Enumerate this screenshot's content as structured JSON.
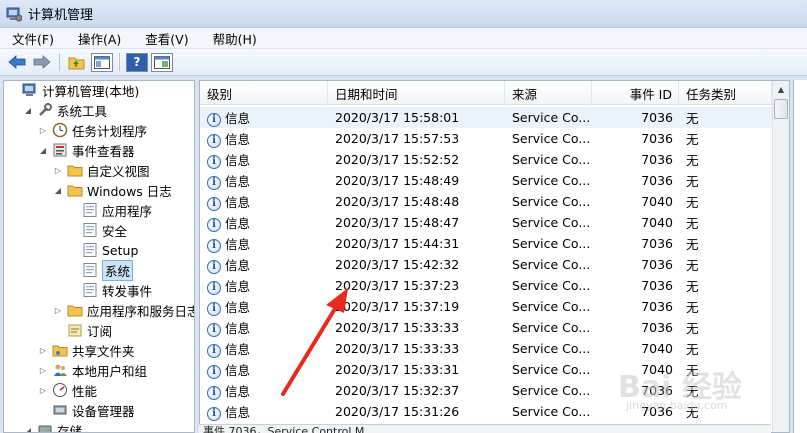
{
  "window": {
    "title": "计算机管理"
  },
  "menu": [
    "文件(F)",
    "操作(A)",
    "查看(V)",
    "帮助(H)"
  ],
  "toolbar": {
    "buttons": [
      "back-arrow-icon",
      "forward-arrow-icon",
      "up-folder-icon",
      "show-hide-tree-icon",
      "help-icon",
      "console-icon"
    ]
  },
  "tree": [
    {
      "label": "计算机管理(本地)",
      "icon": "computer-icon",
      "level": 0,
      "expander": ""
    },
    {
      "label": "系统工具",
      "icon": "tools-icon",
      "level": 1,
      "expander": "◢"
    },
    {
      "label": "任务计划程序",
      "icon": "clock-icon",
      "level": 2,
      "expander": "▷"
    },
    {
      "label": "事件查看器",
      "icon": "event-viewer-icon",
      "level": 2,
      "expander": "◢"
    },
    {
      "label": "自定义视图",
      "icon": "folder-icon",
      "level": 3,
      "expander": "▷"
    },
    {
      "label": "Windows 日志",
      "icon": "folder-icon",
      "level": 3,
      "expander": "◢"
    },
    {
      "label": "应用程序",
      "icon": "log-icon",
      "level": 4,
      "expander": ""
    },
    {
      "label": "安全",
      "icon": "log-icon",
      "level": 4,
      "expander": ""
    },
    {
      "label": "Setup",
      "icon": "log-icon",
      "level": 4,
      "expander": ""
    },
    {
      "label": "系统",
      "icon": "log-icon",
      "level": 4,
      "expander": "",
      "selected": true
    },
    {
      "label": "转发事件",
      "icon": "log-icon",
      "level": 4,
      "expander": ""
    },
    {
      "label": "应用程序和服务日志",
      "icon": "folder-icon",
      "level": 3,
      "expander": "▷"
    },
    {
      "label": "订阅",
      "icon": "subscription-icon",
      "level": 3,
      "expander": ""
    },
    {
      "label": "共享文件夹",
      "icon": "shared-folder-icon",
      "level": 2,
      "expander": "▷"
    },
    {
      "label": "本地用户和组",
      "icon": "users-icon",
      "level": 2,
      "expander": "▷"
    },
    {
      "label": "性能",
      "icon": "performance-icon",
      "level": 2,
      "expander": "▷"
    },
    {
      "label": "设备管理器",
      "icon": "device-manager-icon",
      "level": 2,
      "expander": ""
    },
    {
      "label": "存储",
      "icon": "storage-icon",
      "level": 1,
      "expander": "◢"
    }
  ],
  "table": {
    "columns": [
      "级别",
      "日期和时间",
      "来源",
      "事件 ID",
      "任务类别"
    ],
    "rows": [
      {
        "level": "信息",
        "datetime": "2020/3/17 15:58:01",
        "source": "Service Co...",
        "event_id": "7036",
        "category": "无"
      },
      {
        "level": "信息",
        "datetime": "2020/3/17 15:57:53",
        "source": "Service Co...",
        "event_id": "7036",
        "category": "无"
      },
      {
        "level": "信息",
        "datetime": "2020/3/17 15:52:52",
        "source": "Service Co...",
        "event_id": "7036",
        "category": "无"
      },
      {
        "level": "信息",
        "datetime": "2020/3/17 15:48:49",
        "source": "Service Co...",
        "event_id": "7036",
        "category": "无"
      },
      {
        "level": "信息",
        "datetime": "2020/3/17 15:48:48",
        "source": "Service Co...",
        "event_id": "7040",
        "category": "无"
      },
      {
        "level": "信息",
        "datetime": "2020/3/17 15:48:47",
        "source": "Service Co...",
        "event_id": "7040",
        "category": "无"
      },
      {
        "level": "信息",
        "datetime": "2020/3/17 15:44:31",
        "source": "Service Co...",
        "event_id": "7036",
        "category": "无"
      },
      {
        "level": "信息",
        "datetime": "2020/3/17 15:42:32",
        "source": "Service Co...",
        "event_id": "7036",
        "category": "无"
      },
      {
        "level": "信息",
        "datetime": "2020/3/17 15:37:23",
        "source": "Service Co...",
        "event_id": "7036",
        "category": "无"
      },
      {
        "level": "信息",
        "datetime": "2020/3/17 15:37:19",
        "source": "Service Co...",
        "event_id": "7036",
        "category": "无"
      },
      {
        "level": "信息",
        "datetime": "2020/3/17 15:33:33",
        "source": "Service Co...",
        "event_id": "7036",
        "category": "无"
      },
      {
        "level": "信息",
        "datetime": "2020/3/17 15:33:33",
        "source": "Service Co...",
        "event_id": "7040",
        "category": "无"
      },
      {
        "level": "信息",
        "datetime": "2020/3/17 15:33:31",
        "source": "Service Co...",
        "event_id": "7040",
        "category": "无"
      },
      {
        "level": "信息",
        "datetime": "2020/3/17 15:32:37",
        "source": "Service Co...",
        "event_id": "7036",
        "category": "无"
      },
      {
        "level": "信息",
        "datetime": "2020/3/17 15:31:26",
        "source": "Service Co...",
        "event_id": "7036",
        "category": "无"
      }
    ]
  },
  "detail": {
    "text": "事件 7036，Service Control M"
  },
  "watermark": {
    "text": "Bai 经验",
    "sub": "jingyan.baidu.com"
  },
  "colors": {
    "annotation_arrow": "#e8291c",
    "selection": "#cde4f7"
  }
}
